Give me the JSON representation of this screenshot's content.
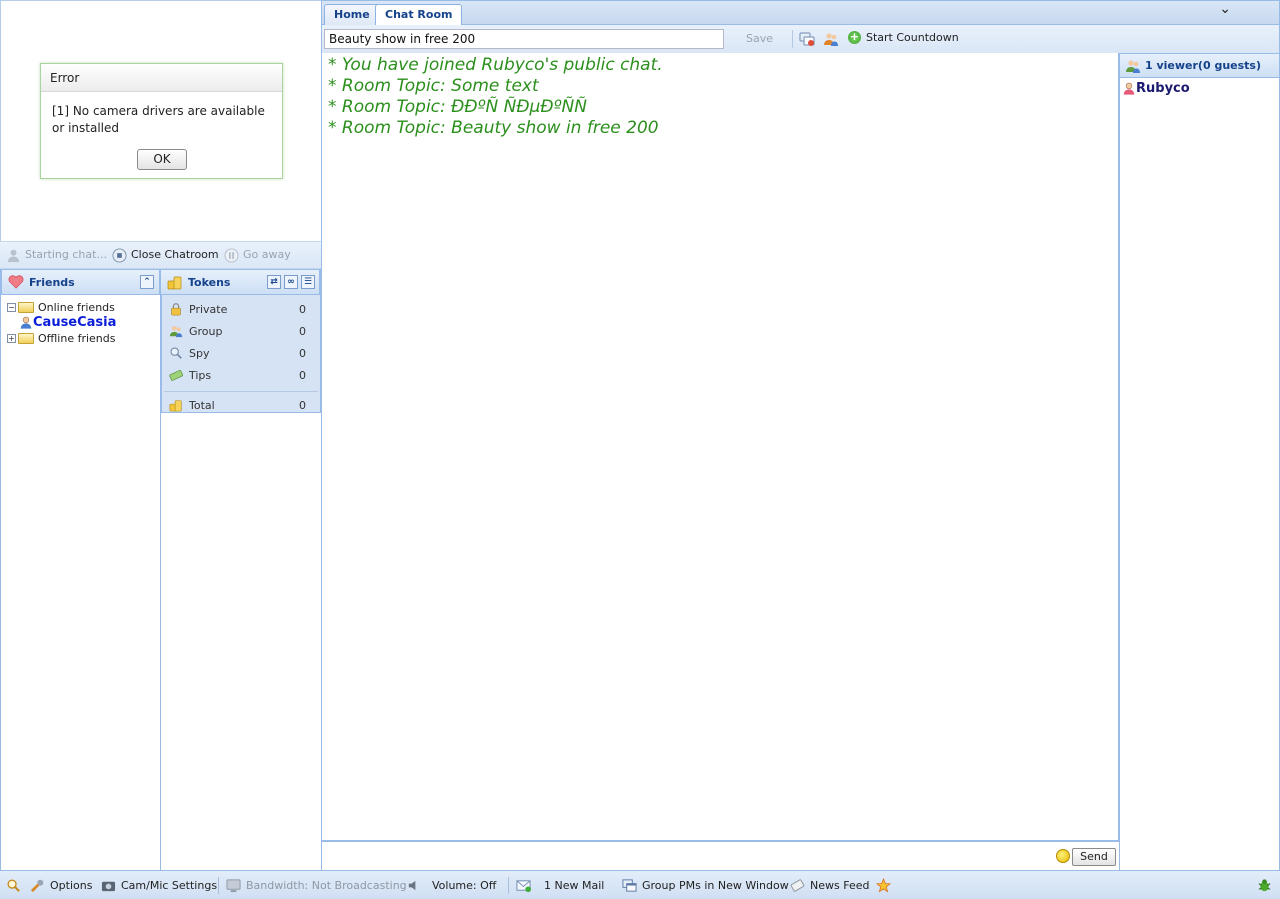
{
  "error_dialog": {
    "title": "Error",
    "message": "[1] No camera drivers are available or installed",
    "ok_label": "OK"
  },
  "controls": {
    "starting_chat": "Starting chat...",
    "close_chatroom": "Close Chatroom",
    "go_away": "Go away"
  },
  "friends": {
    "header": "Friends",
    "online_group": "Online friends",
    "online_list": [
      "CauseCasia"
    ],
    "offline_group": "Offline friends"
  },
  "tokens": {
    "header": "Tokens",
    "rows": [
      {
        "label": "Private",
        "value": "0"
      },
      {
        "label": "Group",
        "value": "0"
      },
      {
        "label": "Spy",
        "value": "0"
      },
      {
        "label": "Tips",
        "value": "0"
      }
    ],
    "total_label": "Total",
    "total_value": "0"
  },
  "tabs": [
    {
      "label": "Home"
    },
    {
      "label": "Chat Room"
    }
  ],
  "topic_bar": {
    "topic_value": "Beauty show in free 200",
    "save_label": "Save",
    "start_countdown": "Start Countdown"
  },
  "chat": {
    "lines": [
      "* You have joined Rubyco's public chat.",
      "* Room Topic: Some text",
      "* Room Topic: ÐÐºÑ ÑÐµÐºÑÑ",
      "* Room Topic: Beauty show in free 200"
    ],
    "color": "#2b8f1c"
  },
  "input": {
    "send_label": "Send"
  },
  "viewers": {
    "header": "1 viewer(0 guests)",
    "list": [
      "Rubyco"
    ]
  },
  "status_bar": {
    "options": "Options",
    "cam_mic": "Cam/Mic Settings",
    "bandwidth": "Bandwidth: Not Broadcasting",
    "volume": "Volume: Off",
    "mail": "1 New Mail",
    "group_pms": "Group PMs in New Window",
    "news_feed": "News Feed"
  },
  "colors": {
    "accent": "#15428b",
    "border": "#99bbe8",
    "friend_online": "#0a1ed8"
  }
}
